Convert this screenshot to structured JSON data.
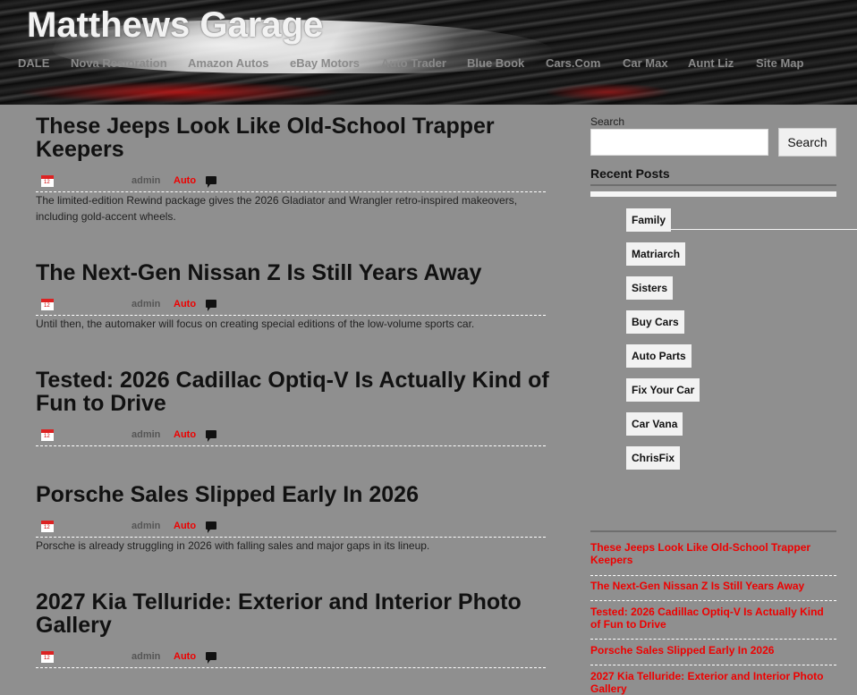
{
  "site": {
    "title": "Matthews Garage"
  },
  "nav": [
    "DALE",
    "Nova Restoration",
    "Amazon Autos",
    "eBay Motors",
    "Auto Trader",
    "Blue Book",
    "Cars.Com",
    "Car Max",
    "Aunt Liz",
    "Site Map"
  ],
  "posts": [
    {
      "title": "These Jeeps Look Like Old-School Trapper Keepers",
      "author": "admin",
      "category": "Auto",
      "excerpt": "The limited-edition Rewind package gives the 2026 Gladiator and Wrangler retro-inspired makeovers, including gold-accent wheels."
    },
    {
      "title": "The Next-Gen Nissan Z Is Still Years Away",
      "author": "admin",
      "category": "Auto",
      "excerpt": "Until then, the automaker will focus on creating special editions of the low-volume sports car."
    },
    {
      "title": "Tested: 2026 Cadillac Optiq-V Is Actually Kind of Fun to Drive",
      "author": "admin",
      "category": "Auto",
      "excerpt": ""
    },
    {
      "title": "Porsche Sales Slipped Early In 2026",
      "author": "admin",
      "category": "Auto",
      "excerpt": "Porsche is already struggling in 2026 with falling sales and major gaps in its lineup."
    },
    {
      "title": "2027 Kia Telluride: Exterior and Interior Photo Gallery",
      "author": "admin",
      "category": "Auto",
      "excerpt": ""
    }
  ],
  "calendar_icon_text": "12",
  "sidebar": {
    "search_label": "Search",
    "search_placeholder": "",
    "search_button": "Search",
    "recent_title": "Recent Posts",
    "menu": [
      "Family",
      "Matriarch",
      "Sisters",
      "Buy Cars",
      "Auto Parts",
      "Fix Your Car",
      "Car Vana",
      "ChrisFix"
    ],
    "recent_posts": [
      "These Jeeps Look Like Old-School Trapper Keepers",
      "The Next-Gen Nissan Z Is Still Years Away",
      "Tested: 2026 Cadillac Optiq-V Is Actually Kind of Fun to Drive",
      "Porsche Sales Slipped Early In 2026",
      "2027 Kia Telluride: Exterior and Interior Photo Gallery"
    ]
  },
  "colors": {
    "background": "#8f8f8f",
    "accent_red": "#e00000",
    "header_dark": "#111111"
  }
}
